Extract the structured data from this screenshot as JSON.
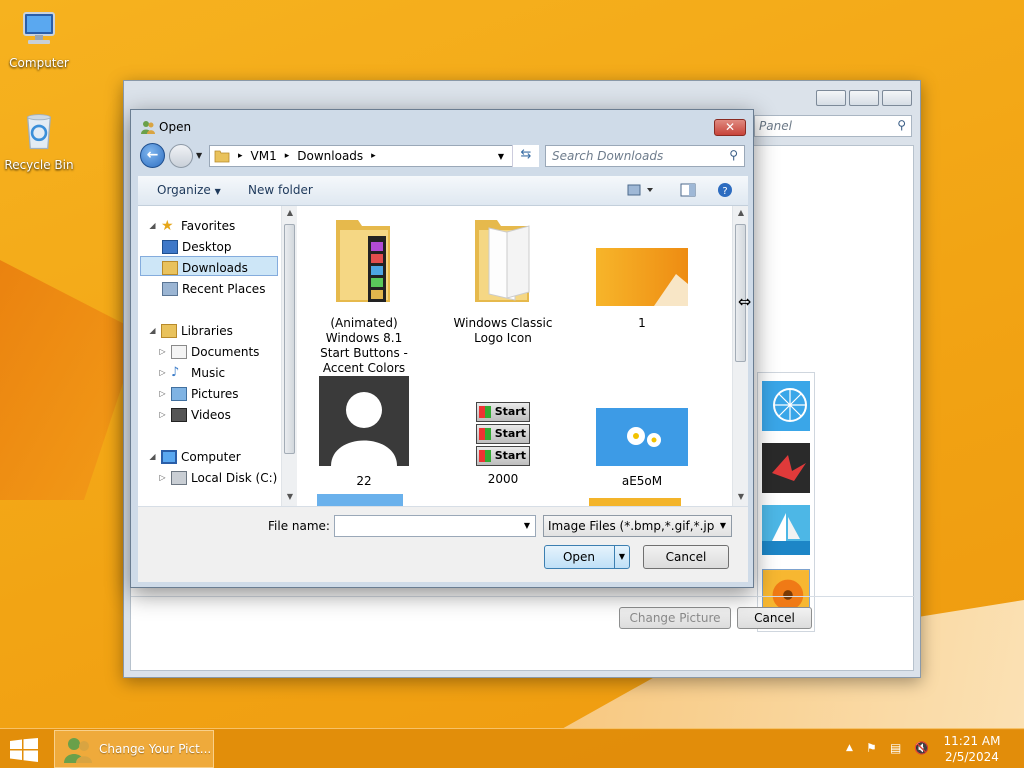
{
  "desktop": {
    "icons": [
      {
        "label": "Computer"
      },
      {
        "label": "Recycle Bin"
      }
    ]
  },
  "background_window": {
    "search_placeholder": "Panel",
    "buttons": {
      "change_picture": "Change Picture",
      "cancel": "Cancel"
    }
  },
  "dialog": {
    "title": "Open",
    "close_label": "✕",
    "address": {
      "segments": [
        "VM1",
        "Downloads"
      ]
    },
    "search_placeholder": "Search Downloads",
    "toolbar": {
      "organize": "Organize",
      "new_folder": "New folder"
    },
    "nav": {
      "favorites": "Favorites",
      "desktop": "Desktop",
      "downloads": "Downloads",
      "recent_places": "Recent Places",
      "libraries": "Libraries",
      "documents": "Documents",
      "music": "Music",
      "pictures": "Pictures",
      "videos": "Videos",
      "computer": "Computer",
      "local_disk": "Local Disk (C:)"
    },
    "files": [
      {
        "name": "(Animated) Windows 8.1 Start Buttons - Accent Colors",
        "kind": "folder"
      },
      {
        "name": "Windows Classic Logo Icon",
        "kind": "folder"
      },
      {
        "name": "1",
        "kind": "image"
      },
      {
        "name": "22",
        "kind": "image"
      },
      {
        "name": "2000",
        "kind": "image"
      },
      {
        "name": "aE5oM",
        "kind": "image"
      }
    ],
    "start_button_text": "Start",
    "file_name_label": "File name:",
    "file_name_value": "",
    "file_type": "Image Files (*.bmp,*.gif,*.jpg,*.",
    "buttons": {
      "open": "Open",
      "cancel": "Cancel"
    }
  },
  "taskbar": {
    "app_label": "Change Your Pict...",
    "time": "11:21 AM",
    "date": "2/5/2024"
  },
  "colors": {
    "accent": "#f2a414",
    "selection": "#cde6f7",
    "taskbar": "#e08c0a"
  }
}
